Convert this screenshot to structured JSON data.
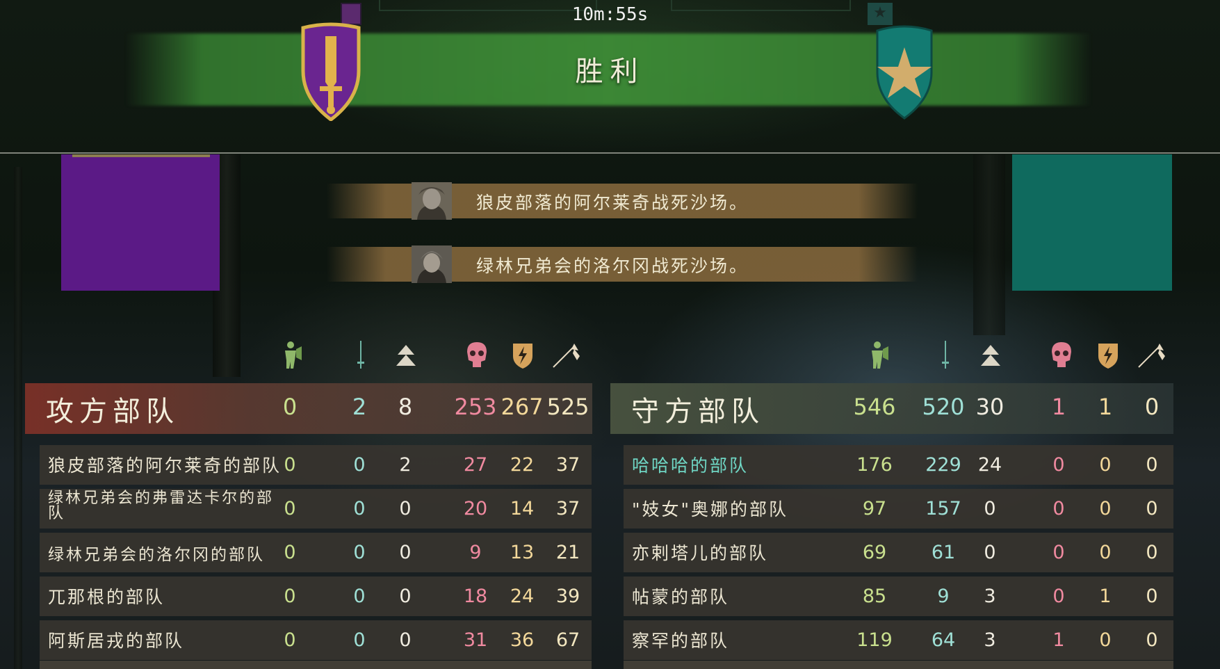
{
  "timer": "10m:55s",
  "banner": {
    "title": "胜利"
  },
  "notices": [
    {
      "text": "狼皮部落的阿尔莱奇战死沙场。"
    },
    {
      "text": "绿林兄弟会的洛尔冈战死沙场。"
    }
  ],
  "columns": [
    "healthy-icon",
    "wounded-icon",
    "routed-icon",
    "killed-icon",
    "hit-icon",
    "ranged-icon"
  ],
  "attacker": {
    "title": "攻方部队",
    "totals": [
      "0",
      "2",
      "8",
      "253",
      "267",
      "525"
    ],
    "parties": [
      {
        "name": "狼皮部落的阿尔莱奇的部队",
        "values": [
          "0",
          "0",
          "2",
          "27",
          "22",
          "37"
        ]
      },
      {
        "name": "绿林兄弟会的弗雷达卡尔的部队",
        "values": [
          "0",
          "0",
          "0",
          "20",
          "14",
          "37"
        ]
      },
      {
        "name": "绿林兄弟会的洛尔冈的部队",
        "values": [
          "0",
          "0",
          "0",
          "9",
          "13",
          "21"
        ]
      },
      {
        "name": "兀那根的部队",
        "values": [
          "0",
          "0",
          "0",
          "18",
          "24",
          "39"
        ]
      },
      {
        "name": "阿斯居戎的部队",
        "values": [
          "0",
          "0",
          "0",
          "31",
          "36",
          "67"
        ]
      }
    ]
  },
  "defender": {
    "title": "守方部队",
    "totals": [
      "546",
      "520",
      "30",
      "1",
      "1",
      "0"
    ],
    "parties": [
      {
        "name": "哈哈哈的部队",
        "values": [
          "176",
          "229",
          "24",
          "0",
          "0",
          "0"
        ]
      },
      {
        "name": "\"妓女\"奥娜的部队",
        "values": [
          "97",
          "157",
          "0",
          "0",
          "0",
          "0"
        ]
      },
      {
        "name": "亦剌塔儿的部队",
        "values": [
          "69",
          "61",
          "0",
          "0",
          "0",
          "0"
        ]
      },
      {
        "name": "帖蒙的部队",
        "values": [
          "85",
          "9",
          "3",
          "0",
          "1",
          "0"
        ]
      },
      {
        "name": "察罕的部队",
        "values": [
          "119",
          "64",
          "3",
          "1",
          "0",
          "0"
        ]
      }
    ]
  },
  "colors": {
    "attacker_banner": "#5b1a86",
    "defender_banner": "#0f6a5e",
    "victory_band": "#3e8c37",
    "notice_band": "#80643a"
  }
}
